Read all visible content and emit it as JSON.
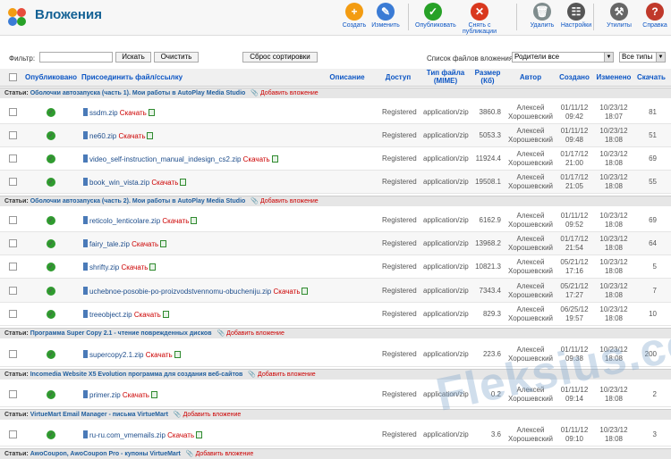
{
  "header": {
    "title": "Вложения",
    "toolbar": [
      {
        "label": "Создать",
        "icon": "plus-icon",
        "color": "#f39c12",
        "glyph": "+"
      },
      {
        "label": "Изменить",
        "icon": "edit-icon",
        "color": "#3a7bd5",
        "glyph": "✎"
      },
      {
        "label": "Опубликовать",
        "icon": "publish-icon",
        "color": "#27a127",
        "glyph": "✓"
      },
      {
        "label": "Снять с публикации",
        "icon": "unpublish-icon",
        "color": "#d9381e",
        "glyph": "✕"
      },
      {
        "label": "Удалить",
        "icon": "trash-icon",
        "color": "#7f8c8d",
        "glyph": "🗑"
      },
      {
        "label": "Настройки",
        "icon": "settings-icon",
        "color": "#555555",
        "glyph": "☷"
      },
      {
        "label": "Утилиты",
        "icon": "tools-icon",
        "color": "#666666",
        "glyph": "⚒"
      },
      {
        "label": "Справка",
        "icon": "help-icon",
        "color": "#c0392b",
        "glyph": "?"
      }
    ]
  },
  "filter": {
    "label": "Фильтр:",
    "value": "",
    "search_btn": "Искать",
    "clear_btn": "Очистить",
    "reset_sort_btn": "Сброс сортировки",
    "list_label": "Список файлов вложения:",
    "list_value": "Родители все",
    "types_value": "Все типы"
  },
  "columns": {
    "published": "Опубликовано",
    "file": "Присоединить файл/ссылку",
    "desc": "Описание",
    "access": "Доступ",
    "type": "Тип файла (MIME)",
    "size": "Размер (Кб)",
    "author": "Автор",
    "created": "Создано",
    "modified": "Изменено",
    "downloads": "Скачать"
  },
  "common": {
    "status_label": "Статьи:",
    "add_attachment": "Добавить вложение",
    "download": "Скачать",
    "access": "Registered",
    "mime": "application/zip",
    "author_first": "Алексей",
    "author_last": "Хорошевский"
  },
  "groups": [
    {
      "title": "Оболочки автозапуска (часть 1). Мои работы в AutoPlay Media Studio",
      "rows": [
        {
          "file": "ssdm.zip",
          "size": "3860.8",
          "c1": "01/11/12",
          "c2": "09:42",
          "m1": "10/23/12",
          "m2": "18:07",
          "dl": "81"
        },
        {
          "file": "ne60.zip",
          "size": "5053.3",
          "c1": "01/11/12",
          "c2": "09:48",
          "m1": "10/23/12",
          "m2": "18:08",
          "dl": "51"
        },
        {
          "file": "video_self-instruction_manual_indesign_cs2.zip",
          "size": "11924.4",
          "c1": "01/17/12",
          "c2": "21:00",
          "m1": "10/23/12",
          "m2": "18:08",
          "dl": "69"
        },
        {
          "file": "book_win_vista.zip",
          "size": "19508.1",
          "c1": "01/17/12",
          "c2": "21:05",
          "m1": "10/23/12",
          "m2": "18:08",
          "dl": "55"
        }
      ]
    },
    {
      "title": "Оболочки автозапуска (часть 2). Мои работы в AutoPlay Media Studio",
      "rows": [
        {
          "file": "reticolo_lenticolare.zip",
          "size": "6162.9",
          "c1": "01/11/12",
          "c2": "09:52",
          "m1": "10/23/12",
          "m2": "18:08",
          "dl": "69"
        },
        {
          "file": "fairy_tale.zip",
          "size": "13968.2",
          "c1": "01/17/12",
          "c2": "21:54",
          "m1": "10/23/12",
          "m2": "18:08",
          "dl": "64"
        },
        {
          "file": "shrifty.zip",
          "size": "10821.3",
          "c1": "05/21/12",
          "c2": "17:16",
          "m1": "10/23/12",
          "m2": "18:08",
          "dl": "5"
        },
        {
          "file": "uchebnoe-posobie-po-proizvodstvennomu-obucheniju.zip",
          "size": "7343.4",
          "c1": "05/21/12",
          "c2": "17:27",
          "m1": "10/23/12",
          "m2": "18:08",
          "dl": "7"
        },
        {
          "file": "treeobject.zip",
          "size": "829.3",
          "c1": "06/25/12",
          "c2": "19:57",
          "m1": "10/23/12",
          "m2": "18:08",
          "dl": "10"
        }
      ]
    },
    {
      "title": "Программа Super Copy 2.1 - чтение поврежденных дисков",
      "rows": [
        {
          "file": "supercopy2.1.zip",
          "size": "223.6",
          "c1": "01/11/12",
          "c2": "09:38",
          "m1": "10/23/12",
          "m2": "18:08",
          "dl": "200"
        }
      ]
    },
    {
      "title": "Incomedia Website X5 Evolution программа для создания веб-сайтов",
      "rows": [
        {
          "file": "primer.zip",
          "size": "0.2",
          "c1": "01/11/12",
          "c2": "09:14",
          "m1": "10/23/12",
          "m2": "18:08",
          "dl": "2"
        }
      ]
    },
    {
      "title": "VirtueMart Email Manager - письма VirtueMart",
      "rows": [
        {
          "file": "ru-ru.com_vmemails.zip",
          "size": "3.6",
          "c1": "01/11/12",
          "c2": "09:10",
          "m1": "10/23/12",
          "m2": "18:08",
          "dl": "3"
        }
      ]
    },
    {
      "title": "AwoCoupon, AwoCoupon Pro - купоны VirtueMart",
      "rows": []
    }
  ],
  "watermark": "Fleksius.com"
}
